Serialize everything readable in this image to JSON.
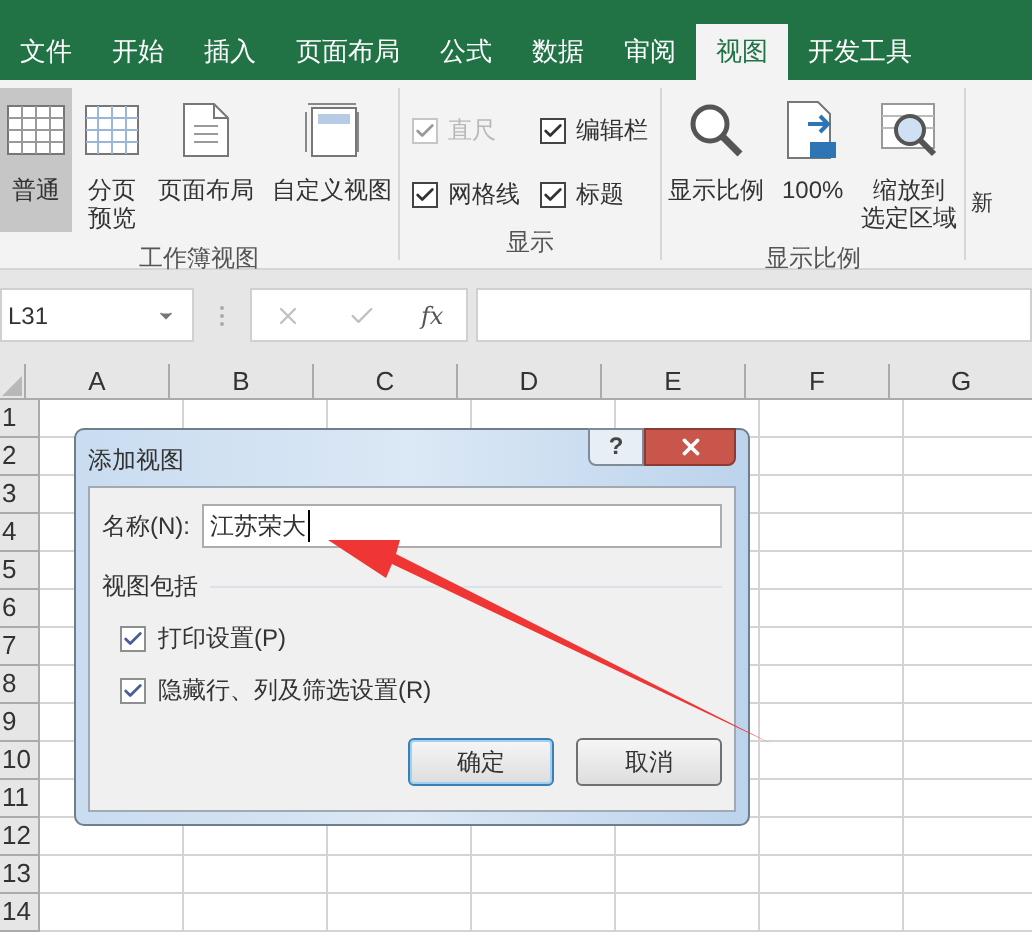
{
  "tabs": [
    {
      "label": "文件",
      "selected": false
    },
    {
      "label": "开始",
      "selected": false
    },
    {
      "label": "插入",
      "selected": false
    },
    {
      "label": "页面布局",
      "selected": false
    },
    {
      "label": "公式",
      "selected": false
    },
    {
      "label": "数据",
      "selected": false
    },
    {
      "label": "审阅",
      "selected": false
    },
    {
      "label": "视图",
      "selected": true
    },
    {
      "label": "开发工具",
      "selected": false
    }
  ],
  "ribbon": {
    "groups": [
      {
        "kind": "buttons",
        "label": "工作簿视图",
        "buttons": [
          {
            "kind": "normal",
            "label": "普通",
            "selected": true
          },
          {
            "kind": "pagebreak",
            "label": [
              "分页",
              "预览"
            ],
            "selected": false
          },
          {
            "kind": "pagelayout",
            "label": "页面布局",
            "selected": false
          },
          {
            "kind": "custom",
            "label": "自定义视图",
            "selected": false
          }
        ]
      },
      {
        "kind": "checks",
        "label": "显示",
        "checks": [
          {
            "label": "直尺",
            "checked": true,
            "disabled": true
          },
          {
            "label": "编辑栏",
            "checked": true,
            "disabled": false
          },
          {
            "label": "网格线",
            "checked": true,
            "disabled": false
          },
          {
            "label": "标题",
            "checked": true,
            "disabled": false
          }
        ]
      },
      {
        "kind": "buttons",
        "label": "显示比例",
        "buttons": [
          {
            "kind": "zoom",
            "label": "显示比例",
            "selected": false
          },
          {
            "kind": "hundred",
            "label": "100%",
            "selected": false
          },
          {
            "kind": "selection",
            "label": [
              "缩放到",
              "选定区域"
            ],
            "selected": false
          }
        ]
      }
    ],
    "cut_label": "新"
  },
  "formula_bar": {
    "name_box": "L31",
    "fx": "fx"
  },
  "sheet": {
    "columns": [
      "A",
      "B",
      "C",
      "D",
      "E",
      "F",
      "G"
    ],
    "rows": [
      "1",
      "2",
      "3",
      "4",
      "5",
      "6",
      "7",
      "8",
      "9",
      "10",
      "11",
      "12",
      "13",
      "14"
    ]
  },
  "dialog": {
    "title": "添加视图",
    "help": "?",
    "name_label": "名称(N):",
    "name_value": "江苏荣大",
    "section": "视图包括",
    "options": [
      {
        "label": "打印设置(P)",
        "checked": true
      },
      {
        "label": "隐藏行、列及筛选设置(R)",
        "checked": true
      }
    ],
    "buttons": [
      {
        "label": "确定",
        "default": true
      },
      {
        "label": "取消",
        "default": false
      }
    ]
  }
}
